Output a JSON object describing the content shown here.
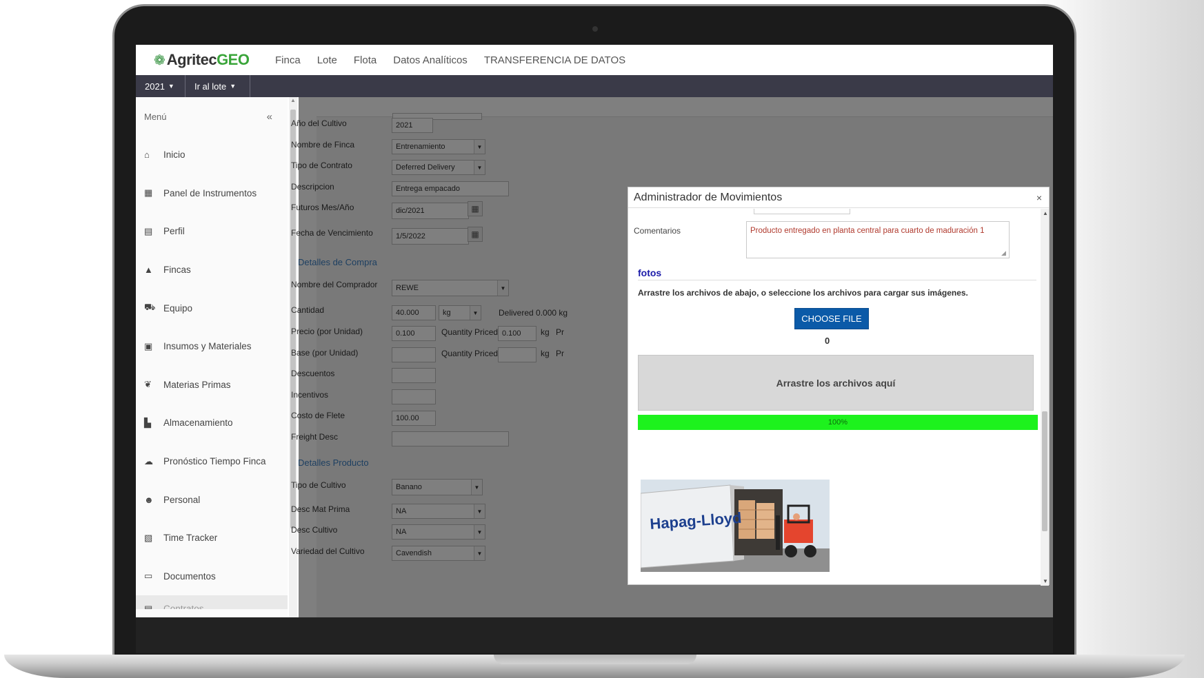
{
  "topnav": {
    "brand_part1": "Agritec",
    "brand_part2": "GEO",
    "links": [
      "Finca",
      "Lote",
      "Flota",
      "Datos Analíticos",
      "TRANSFERENCIA DE DATOS"
    ]
  },
  "subbar": {
    "year": "2021",
    "goto_lote": "Ir al lote"
  },
  "sidebar": {
    "title": "Menú",
    "collapse": "«",
    "items": [
      {
        "label": "Inicio",
        "icon": "home-icon"
      },
      {
        "label": "Panel de Instrumentos",
        "icon": "dashboard-icon"
      },
      {
        "label": "Perfil",
        "icon": "profile-card-icon"
      },
      {
        "label": "Fincas",
        "icon": "farm-icon"
      },
      {
        "label": "Equipo",
        "icon": "tractor-icon"
      },
      {
        "label": "Insumos y Materiales",
        "icon": "supplies-icon"
      },
      {
        "label": "Materias Primas",
        "icon": "plant-icon"
      },
      {
        "label": "Almacenamiento",
        "icon": "storage-icon"
      },
      {
        "label": "Pronóstico Tiempo Finca",
        "icon": "weather-icon"
      },
      {
        "label": "Personal",
        "icon": "people-icon"
      },
      {
        "label": "Time Tracker",
        "icon": "calendar-clock-icon"
      },
      {
        "label": "Documentos",
        "icon": "document-icon"
      },
      {
        "label": "Contratos",
        "icon": "contract-icon"
      }
    ]
  },
  "form": {
    "anio_cultivo": {
      "label": "Año del Cultivo",
      "value": "2021"
    },
    "nombre_finca": {
      "label": "Nombre de Finca",
      "value": "Entrenamiento"
    },
    "tipo_contrato": {
      "label": "Tipo de Contrato",
      "value": "Deferred Delivery"
    },
    "descripcion": {
      "label": "Descripcion",
      "value": "Entrega empacado"
    },
    "futuros": {
      "label": "Futuros Mes/Año",
      "value": "dic/2021"
    },
    "vencimiento": {
      "label": "Fecha de Vencimiento",
      "value": "1/5/2022"
    },
    "detalles_compra": "Detalles de Compra",
    "comprador": {
      "label": "Nombre del Comprador",
      "value": "REWE"
    },
    "cantidad": {
      "label": "Cantidad",
      "value": "40.000",
      "unit": "kg",
      "delivered": "Delivered 0.000 kg"
    },
    "precio": {
      "label": "Precio (por Unidad)",
      "value": "0.100",
      "qp_label": "Quantity Priced",
      "qp_value": "0.100",
      "unit": "kg",
      "extra": "Pr"
    },
    "base": {
      "label": "Base (por Unidad)",
      "value": "",
      "qp_label": "Quantity Priced",
      "qp_value": "",
      "unit": "kg",
      "extra": "Pr"
    },
    "descuentos": {
      "label": "Descuentos",
      "value": ""
    },
    "incentivos": {
      "label": "Incentivos",
      "value": ""
    },
    "costo_flete": {
      "label": "Costo de Flete",
      "value": "100.00"
    },
    "freight_desc": {
      "label": "Freight Desc",
      "value": ""
    },
    "detalles_producto": "Detalles Producto",
    "tipo_cultivo": {
      "label": "Tipo de Cultivo",
      "value": "Banano"
    },
    "desc_mat_prima": {
      "label": "Desc Mat Prima",
      "value": "NA"
    },
    "desc_cultivo": {
      "label": "Desc Cultivo",
      "value": "NA"
    },
    "variedad": {
      "label": "Variedad del Cultivo",
      "value": "Cavendish"
    }
  },
  "modal": {
    "title": "Administrador de Movimientos",
    "close": "×",
    "comentarios_label": "Comentarios",
    "comentarios_value": "Producto entregado en planta central para cuarto de maduración 1",
    "fotos_title": "fotos",
    "instructions": "Arrastre los archivos de abajo, o seleccione los archivos para cargar sus imágenes.",
    "choose_file": "CHOOSE FILE",
    "file_count": "0",
    "dropzone": "Arrastre los archivos aquí",
    "progress_label": "100%",
    "progress": 1.0,
    "photo_brand": "Hapag-Lloyd"
  }
}
